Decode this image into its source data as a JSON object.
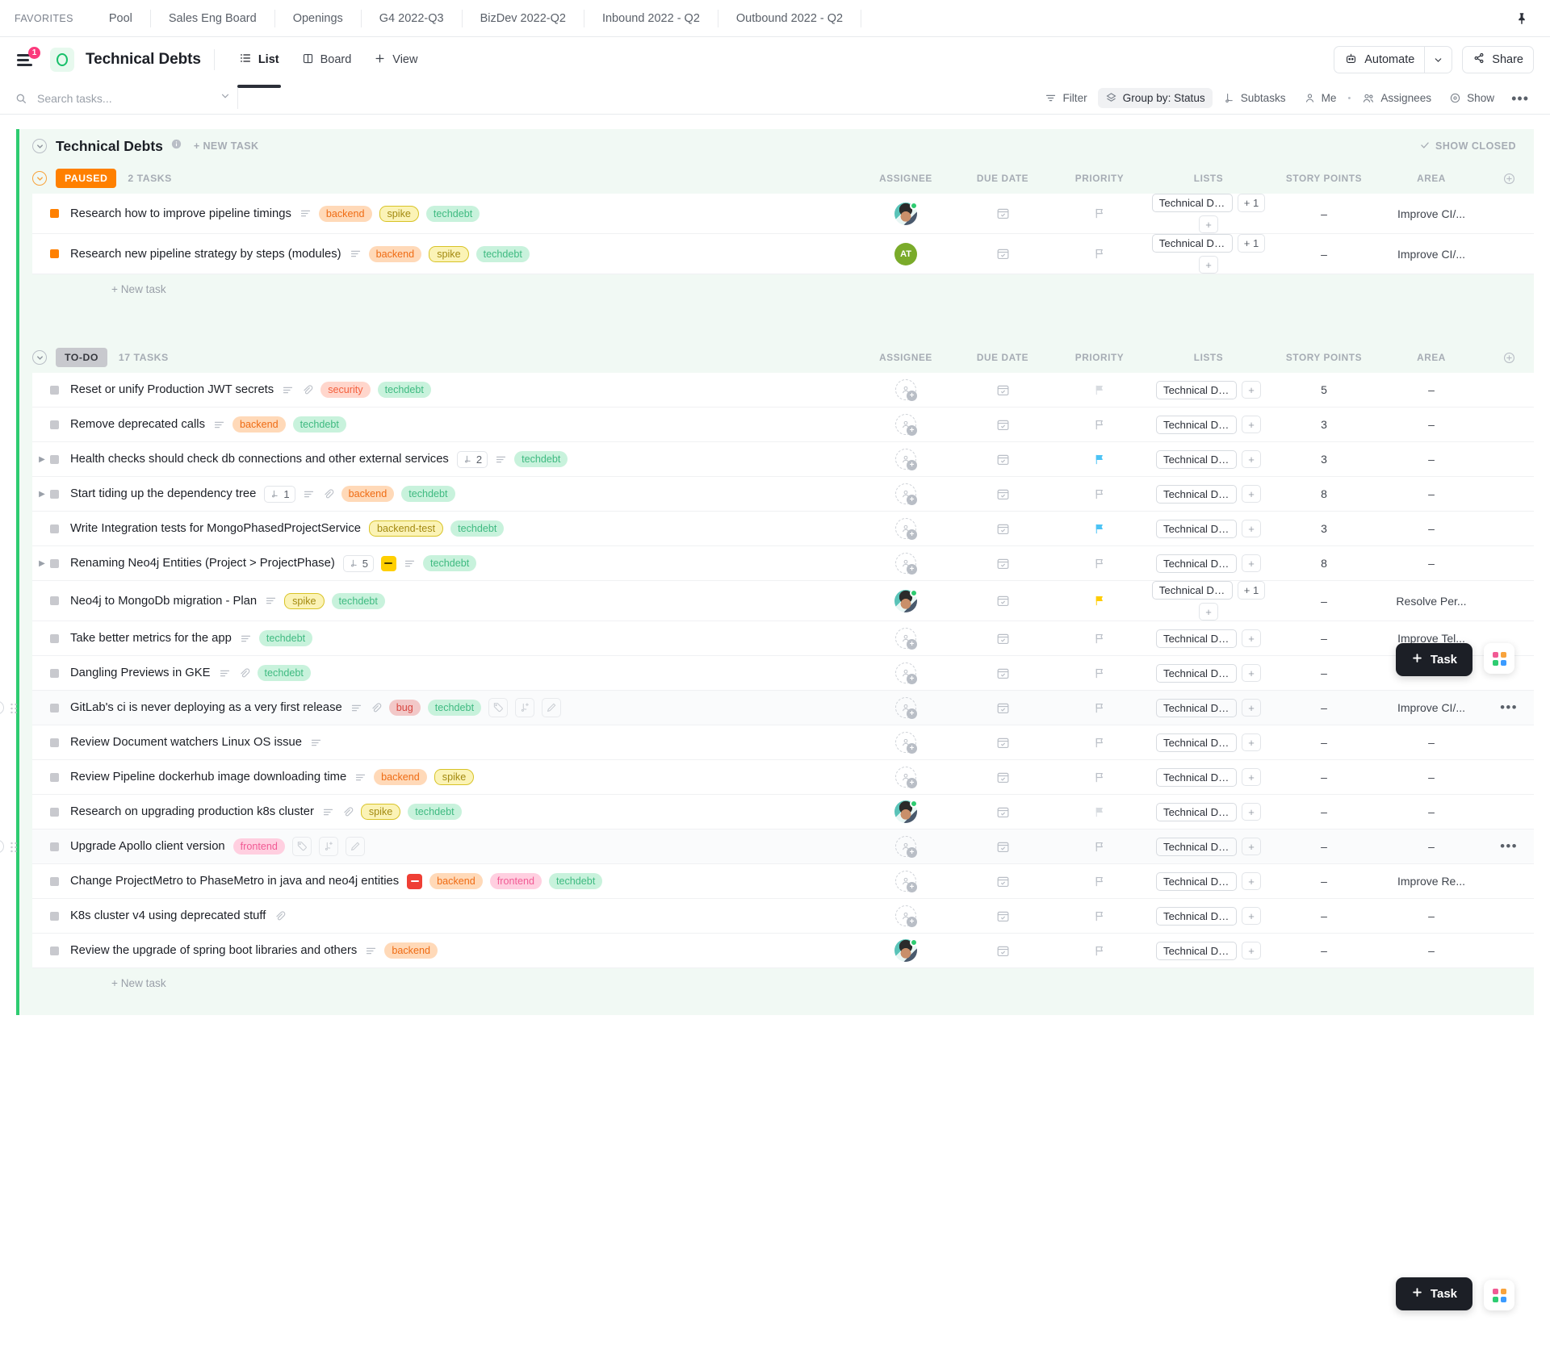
{
  "favorites": {
    "label": "FAVORITES",
    "items": [
      "Pool",
      "Sales Eng Board",
      "Openings",
      "G4 2022-Q3",
      "BizDev 2022-Q2",
      "Inbound 2022 - Q2",
      "Outbound 2022 - Q2"
    ]
  },
  "header": {
    "title": "Technical Debts",
    "notification_count": "1",
    "views": [
      {
        "label": "List",
        "icon": "list-icon",
        "active": true
      },
      {
        "label": "Board",
        "icon": "board-icon",
        "active": false
      },
      {
        "label": "View",
        "icon": "plus-icon",
        "active": false
      }
    ],
    "automate_label": "Automate",
    "share_label": "Share"
  },
  "toolbar": {
    "search_placeholder": "Search tasks...",
    "search_value": "",
    "items": [
      {
        "label": "Filter",
        "icon": "filter-icon",
        "active": false
      },
      {
        "label": "Group by: Status",
        "icon": "group-icon",
        "active": true
      },
      {
        "label": "Subtasks",
        "icon": "subtasks-icon",
        "active": false
      },
      {
        "label": "Me",
        "icon": "person-icon",
        "active": false
      },
      {
        "label": "Assignees",
        "icon": "people-icon",
        "active": false
      },
      {
        "label": "Show",
        "icon": "eye-icon",
        "active": false
      }
    ],
    "more_label": "•••"
  },
  "list": {
    "title": "Technical Debts",
    "new_task_label": "+ NEW TASK",
    "show_closed_label": "SHOW CLOSED",
    "accent_color": "#2ecc71",
    "new_task_row_label": "+ New task"
  },
  "columns": [
    "ASSIGNEE",
    "DUE DATE",
    "PRIORITY",
    "LISTS",
    "STORY POINTS",
    "AREA"
  ],
  "groups": [
    {
      "status": "PAUSED",
      "status_color": "#ff8000",
      "count_label": "2 TASKS",
      "tasks": [
        {
          "name": "Research how to improve pipeline timings",
          "dot_color": "#ff8000",
          "expandable": false,
          "subtask_count": "",
          "has_description": true,
          "has_attachment": false,
          "emoji": "",
          "tags": [
            {
              "label": "backend",
              "style": "backend"
            },
            {
              "label": "spike",
              "style": "spike"
            },
            {
              "label": "techdebt",
              "style": "techdebt"
            }
          ],
          "assignee": {
            "type": "photo",
            "initials": ""
          },
          "priority": "none",
          "lists": "Technical Deb...",
          "lists_extra": "+ 1",
          "points": "–",
          "area": "Improve CI/...",
          "hover": false
        },
        {
          "name": "Research new pipeline strategy by steps (modules)",
          "dot_color": "#ff8000",
          "expandable": false,
          "subtask_count": "",
          "has_description": true,
          "has_attachment": false,
          "emoji": "",
          "tags": [
            {
              "label": "backend",
              "style": "backend"
            },
            {
              "label": "spike",
              "style": "spike"
            },
            {
              "label": "techdebt",
              "style": "techdebt"
            }
          ],
          "assignee": {
            "type": "initials",
            "initials": "AT"
          },
          "priority": "none",
          "lists": "Technical Deb...",
          "lists_extra": "+ 1",
          "points": "–",
          "area": "Improve CI/...",
          "hover": false
        }
      ]
    },
    {
      "status": "TO-DO",
      "status_color": "#c8c9ce",
      "count_label": "17 TASKS",
      "tasks": [
        {
          "name": "Reset or unify Production JWT secrets",
          "dot_color": "#c8c9ce",
          "expandable": false,
          "subtask_count": "",
          "has_description": true,
          "has_attachment": true,
          "emoji": "",
          "tags": [
            {
              "label": "security",
              "style": "security"
            },
            {
              "label": "techdebt",
              "style": "techdebt"
            }
          ],
          "assignee": {
            "type": "empty",
            "initials": ""
          },
          "priority": "grey-filled",
          "lists": "Technical Deb...",
          "lists_extra": "",
          "points": "5",
          "area": "–",
          "hover": false
        },
        {
          "name": "Remove deprecated calls",
          "dot_color": "#c8c9ce",
          "expandable": false,
          "subtask_count": "",
          "has_description": true,
          "has_attachment": false,
          "emoji": "",
          "tags": [
            {
              "label": "backend",
              "style": "backend"
            },
            {
              "label": "techdebt",
              "style": "techdebt"
            }
          ],
          "assignee": {
            "type": "empty",
            "initials": ""
          },
          "priority": "none",
          "lists": "Technical Deb...",
          "lists_extra": "",
          "points": "3",
          "area": "–",
          "hover": false
        },
        {
          "name": "Health checks should check db connections and other external services",
          "dot_color": "#c8c9ce",
          "expandable": true,
          "subtask_count": "2",
          "has_description": true,
          "has_attachment": false,
          "emoji": "",
          "tags": [
            {
              "label": "techdebt",
              "style": "techdebt"
            }
          ],
          "assignee": {
            "type": "empty",
            "initials": ""
          },
          "priority": "blue",
          "lists": "Technical Deb...",
          "lists_extra": "",
          "points": "3",
          "area": "–",
          "hover": false
        },
        {
          "name": "Start tiding up the dependency tree",
          "dot_color": "#c8c9ce",
          "expandable": true,
          "subtask_count": "1",
          "has_description": true,
          "has_attachment": true,
          "emoji": "",
          "tags": [
            {
              "label": "backend",
              "style": "backend"
            },
            {
              "label": "techdebt",
              "style": "techdebt"
            }
          ],
          "assignee": {
            "type": "empty",
            "initials": ""
          },
          "priority": "none",
          "lists": "Technical Deb...",
          "lists_extra": "",
          "points": "8",
          "area": "–",
          "hover": false
        },
        {
          "name": "Write Integration tests for MongoPhasedProjectService",
          "dot_color": "#c8c9ce",
          "expandable": false,
          "subtask_count": "",
          "has_description": false,
          "has_attachment": false,
          "emoji": "",
          "tags": [
            {
              "label": "backend-test",
              "style": "backendtest"
            },
            {
              "label": "techdebt",
              "style": "techdebt"
            }
          ],
          "assignee": {
            "type": "empty",
            "initials": ""
          },
          "priority": "blue",
          "lists": "Technical Deb...",
          "lists_extra": "",
          "points": "3",
          "area": "–",
          "hover": false
        },
        {
          "name": "Renaming Neo4j Entities (Project > ProjectPhase)",
          "dot_color": "#c8c9ce",
          "expandable": true,
          "subtask_count": "5",
          "has_description": true,
          "has_attachment": false,
          "emoji": "no-entry-yellow",
          "tags": [
            {
              "label": "techdebt",
              "style": "techdebt"
            }
          ],
          "assignee": {
            "type": "empty",
            "initials": ""
          },
          "priority": "none",
          "lists": "Technical Deb...",
          "lists_extra": "",
          "points": "8",
          "area": "–",
          "hover": false
        },
        {
          "name": "Neo4j to MongoDb migration - Plan",
          "dot_color": "#c8c9ce",
          "expandable": false,
          "subtask_count": "",
          "has_description": true,
          "has_attachment": false,
          "emoji": "",
          "tags": [
            {
              "label": "spike",
              "style": "spike"
            },
            {
              "label": "techdebt",
              "style": "techdebt"
            }
          ],
          "assignee": {
            "type": "photo",
            "initials": ""
          },
          "priority": "yellow",
          "lists": "Technical Deb...",
          "lists_extra": "+ 1",
          "points": "–",
          "area": "Resolve Per...",
          "hover": false
        },
        {
          "name": "Take better metrics for the app",
          "dot_color": "#c8c9ce",
          "expandable": false,
          "subtask_count": "",
          "has_description": true,
          "has_attachment": false,
          "emoji": "",
          "tags": [
            {
              "label": "techdebt",
              "style": "techdebt"
            }
          ],
          "assignee": {
            "type": "empty",
            "initials": ""
          },
          "priority": "none",
          "lists": "Technical Deb...",
          "lists_extra": "",
          "points": "–",
          "area": "Improve Tel...",
          "hover": false
        },
        {
          "name": "Dangling Previews in GKE",
          "dot_color": "#c8c9ce",
          "expandable": false,
          "subtask_count": "",
          "has_description": true,
          "has_attachment": true,
          "emoji": "",
          "tags": [
            {
              "label": "techdebt",
              "style": "techdebt"
            }
          ],
          "assignee": {
            "type": "empty",
            "initials": ""
          },
          "priority": "none",
          "lists": "Technical Deb...",
          "lists_extra": "",
          "points": "–",
          "area": "–",
          "hover": false
        },
        {
          "name": "GitLab's ci is never deploying as a very first release",
          "dot_color": "#c8c9ce",
          "expandable": false,
          "subtask_count": "",
          "has_description": true,
          "has_attachment": true,
          "emoji": "",
          "tags": [
            {
              "label": "bug",
              "style": "bug"
            },
            {
              "label": "techdebt",
              "style": "techdebt"
            }
          ],
          "assignee": {
            "type": "empty",
            "initials": ""
          },
          "priority": "none",
          "lists": "Technical Deb...",
          "lists_extra": "",
          "points": "–",
          "area": "Improve CI/...",
          "hover": true,
          "hover_actions": [
            "tag-icon",
            "subtask-add-icon",
            "edit-icon"
          ],
          "row_more": "•••"
        },
        {
          "name": "Review Document watchers Linux OS issue",
          "dot_color": "#c8c9ce",
          "expandable": false,
          "subtask_count": "",
          "has_description": true,
          "has_attachment": false,
          "emoji": "",
          "tags": [],
          "assignee": {
            "type": "empty",
            "initials": ""
          },
          "priority": "none",
          "lists": "Technical Deb...",
          "lists_extra": "",
          "points": "–",
          "area": "–",
          "hover": false
        },
        {
          "name": "Review Pipeline dockerhub image downloading time",
          "dot_color": "#c8c9ce",
          "expandable": false,
          "subtask_count": "",
          "has_description": true,
          "has_attachment": false,
          "emoji": "",
          "tags": [
            {
              "label": "backend",
              "style": "backend"
            },
            {
              "label": "spike",
              "style": "spike"
            }
          ],
          "assignee": {
            "type": "empty",
            "initials": ""
          },
          "priority": "none",
          "lists": "Technical Deb...",
          "lists_extra": "",
          "points": "–",
          "area": "–",
          "hover": false
        },
        {
          "name": "Research on upgrading production k8s cluster",
          "dot_color": "#c8c9ce",
          "expandable": false,
          "subtask_count": "",
          "has_description": true,
          "has_attachment": true,
          "emoji": "",
          "tags": [
            {
              "label": "spike",
              "style": "spike"
            },
            {
              "label": "techdebt",
              "style": "techdebt"
            }
          ],
          "assignee": {
            "type": "photo",
            "initials": ""
          },
          "priority": "grey-filled",
          "lists": "Technical Deb...",
          "lists_extra": "",
          "points": "–",
          "area": "–",
          "hover": false
        },
        {
          "name": "Upgrade Apollo client version",
          "dot_color": "#c8c9ce",
          "expandable": false,
          "subtask_count": "",
          "has_description": false,
          "has_attachment": false,
          "emoji": "",
          "tags": [
            {
              "label": "frontend",
              "style": "frontend"
            }
          ],
          "assignee": {
            "type": "empty",
            "initials": ""
          },
          "priority": "none",
          "lists": "Technical Deb...",
          "lists_extra": "",
          "points": "–",
          "area": "–",
          "hover": true,
          "hover_actions": [
            "tag-icon",
            "subtask-add-icon",
            "edit-icon"
          ],
          "row_more": "•••"
        },
        {
          "name": "Change ProjectMetro to PhaseMetro in java and neo4j entities",
          "dot_color": "#c8c9ce",
          "expandable": false,
          "subtask_count": "",
          "has_description": false,
          "has_attachment": false,
          "emoji": "no-entry-red",
          "tags": [
            {
              "label": "backend",
              "style": "backend"
            },
            {
              "label": "frontend",
              "style": "frontend"
            },
            {
              "label": "techdebt",
              "style": "techdebt"
            }
          ],
          "assignee": {
            "type": "empty",
            "initials": ""
          },
          "priority": "none",
          "lists": "Technical Deb...",
          "lists_extra": "",
          "points": "–",
          "area": "Improve Re...",
          "hover": false
        },
        {
          "name": "K8s cluster v4 using deprecated stuff",
          "dot_color": "#c8c9ce",
          "expandable": false,
          "subtask_count": "",
          "has_description": false,
          "has_attachment": true,
          "emoji": "",
          "tags": [],
          "assignee": {
            "type": "empty",
            "initials": ""
          },
          "priority": "none",
          "lists": "Technical Deb...",
          "lists_extra": "",
          "points": "–",
          "area": "–",
          "hover": false
        },
        {
          "name": "Review the upgrade of spring boot libraries and others",
          "dot_color": "#c8c9ce",
          "expandable": false,
          "subtask_count": "",
          "has_description": true,
          "has_attachment": false,
          "emoji": "",
          "tags": [
            {
              "label": "backend",
              "style": "backend"
            }
          ],
          "assignee": {
            "type": "photo",
            "initials": ""
          },
          "priority": "none",
          "lists": "Technical Deb...",
          "lists_extra": "",
          "points": "–",
          "area": "–",
          "hover": false
        }
      ]
    }
  ],
  "floating": {
    "task_button_label": "Task",
    "apps_colors": [
      "#f15a94",
      "#f8a33c",
      "#2ecc71",
      "#3b9bff"
    ]
  }
}
